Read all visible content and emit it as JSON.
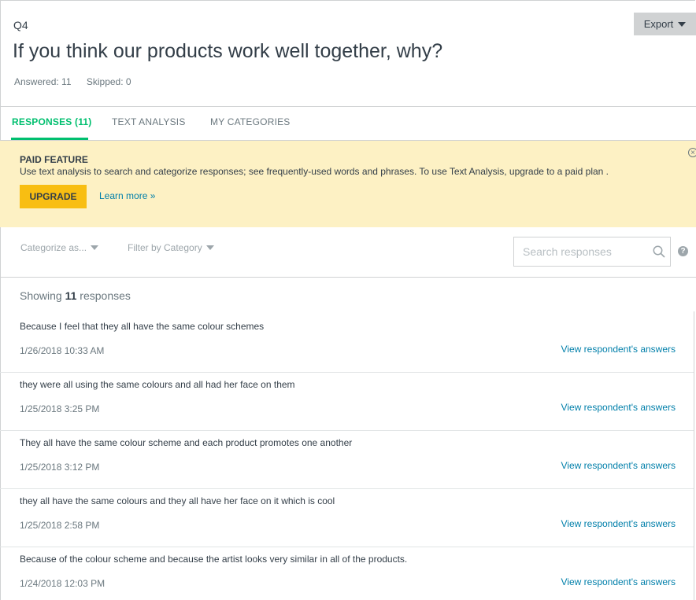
{
  "question": {
    "number": "Q4",
    "title": "If you think our products work well together, why?",
    "answered": "Answered: 11",
    "skipped": "Skipped: 0"
  },
  "export_label": "Export",
  "tabs": [
    {
      "label": "RESPONSES (11)",
      "active": true
    },
    {
      "label": "TEXT ANALYSIS",
      "active": false
    },
    {
      "label": "MY CATEGORIES",
      "active": false
    }
  ],
  "paid_feature": {
    "title": "PAID FEATURE",
    "description": "Use text analysis to search and categorize responses; see frequently-used words and phrases. To use Text Analysis, upgrade to a paid plan .",
    "upgrade_label": "UPGRADE",
    "learn_more": "Learn more »",
    "close_icon": "close-circle-icon"
  },
  "filters": {
    "categorize_label": "Categorize as...",
    "filter_label": "Filter by Category",
    "search_placeholder": "Search responses",
    "help": "?"
  },
  "showing": {
    "prefix": "Showing ",
    "count": "11",
    "suffix": " responses"
  },
  "responses": [
    {
      "text": "Because I feel that they all have the same colour schemes",
      "date": "1/26/2018 10:33 AM",
      "link": "View respondent's answers"
    },
    {
      "text": "they were all using the same colours and all had her face on them",
      "date": "1/25/2018 3:25 PM",
      "link": "View respondent's answers"
    },
    {
      "text": "They all have the same colour scheme and each product promotes one another",
      "date": "1/25/2018 3:12 PM",
      "link": "View respondent's answers"
    },
    {
      "text": "they all have the same colours and they all have her face on it which is cool",
      "date": "1/25/2018 2:58 PM",
      "link": "View respondent's answers"
    },
    {
      "text": "Because of the colour scheme and because the artist looks very similar in all of the products.",
      "date": "1/24/2018 12:03 PM",
      "link": "View respondent's answers"
    }
  ],
  "colors": {
    "accent_green": "#00bf6f",
    "banner_yellow": "#fdf1c4",
    "upgrade_yellow": "#f8be12",
    "link_blue": "#007faa"
  }
}
